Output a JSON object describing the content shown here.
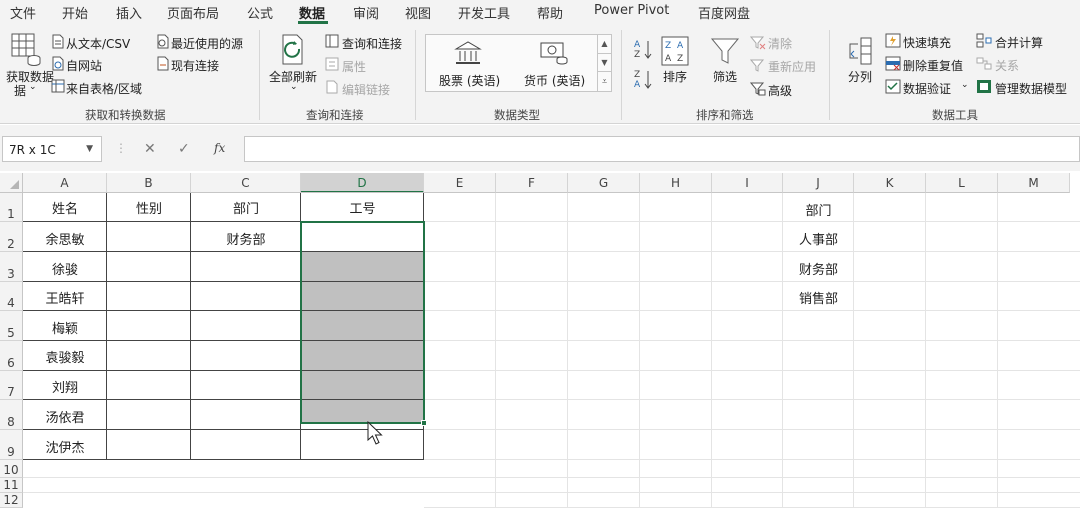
{
  "menu": {
    "tabs": [
      {
        "label": "文件"
      },
      {
        "label": "开始"
      },
      {
        "label": "插入"
      },
      {
        "label": "页面布局"
      },
      {
        "label": "公式"
      },
      {
        "label": "数据"
      },
      {
        "label": "审阅"
      },
      {
        "label": "视图"
      },
      {
        "label": "开发工具"
      },
      {
        "label": "帮助"
      },
      {
        "label": "Power Pivot"
      },
      {
        "label": "百度网盘"
      }
    ],
    "active": "数据"
  },
  "ribbon": {
    "get_transform": {
      "get_data": "获取数据",
      "get_data_line2": "据",
      "from_text": "从文本/CSV",
      "from_web": "自网站",
      "from_table": "来自表格/区域",
      "recent_sources": "最近使用的源",
      "existing_conn": "现有连接",
      "group_label": "获取和转换数据"
    },
    "queries": {
      "refresh_all": "全部刷新",
      "queries_conn": "查询和连接",
      "properties": "属性",
      "edit_links": "编辑链接",
      "group_label": "查询和连接"
    },
    "data_types": {
      "stocks": "股票 (英语)",
      "currency": "货币 (英语)",
      "group_label": "数据类型"
    },
    "sort_filter": {
      "sort": "排序",
      "filter": "筛选",
      "clear": "清除",
      "reapply": "重新应用",
      "advanced": "高级",
      "group_label": "排序和筛选"
    },
    "data_tools": {
      "text_to_columns": "分列",
      "flash_fill": "快速填充",
      "remove_dup": "删除重复值",
      "validation": "数据验证",
      "consolidate": "合并计算",
      "relationships": "关系",
      "manage_model": "管理数据模型",
      "group_label": "数据工具"
    }
  },
  "formula_bar": {
    "name_box": "7R x 1C",
    "fx": "fx",
    "value": ""
  },
  "grid": {
    "columns": [
      "A",
      "B",
      "C",
      "D",
      "E",
      "F",
      "G",
      "H",
      "I",
      "J",
      "K",
      "L",
      "M"
    ],
    "rows": [
      "1",
      "2",
      "3",
      "4",
      "5",
      "6",
      "7",
      "8",
      "9",
      "10",
      "11",
      "12"
    ],
    "header_row": {
      "A": "姓名",
      "B": "性别",
      "C": "部门",
      "D": "工号"
    },
    "names": [
      "余思敏",
      "徐骏",
      "王皓轩",
      "梅颖",
      "袁骏毅",
      "刘翔",
      "汤依君",
      "沈伊杰"
    ],
    "c2": "财务部",
    "j_column": [
      "部门",
      "人事部",
      "财务部",
      "销售部"
    ]
  },
  "colors": {
    "accent": "#217346",
    "selection_fill": "#c0c0c0"
  }
}
